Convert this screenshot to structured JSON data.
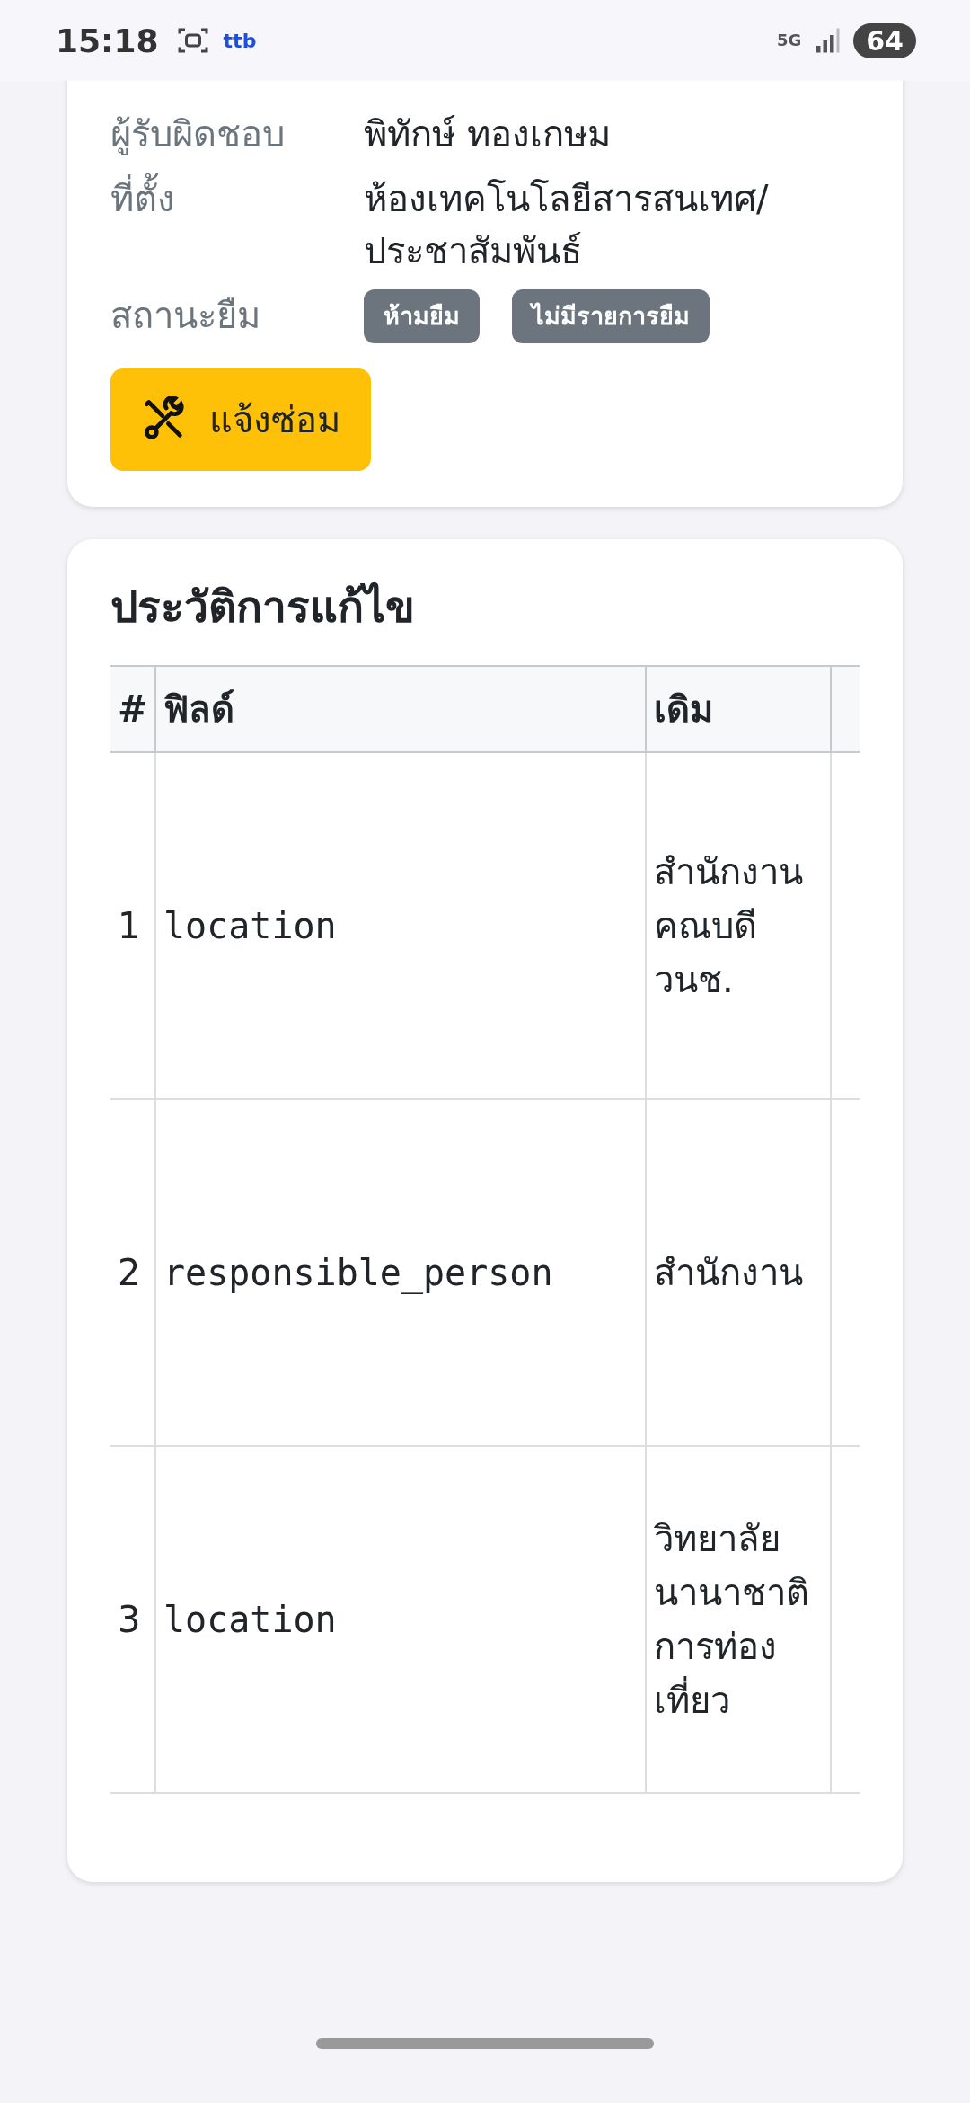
{
  "status_bar": {
    "time": "15:18",
    "app_logo": "ttb",
    "network": "5G",
    "battery": "64"
  },
  "details": [
    {
      "label": "ผู้รับผิดชอบ",
      "value": "พิทักษ์ ทองเกษม"
    },
    {
      "label": "ที่ตั้ง",
      "value": "ห้องเทคโนโลยีสารสนเทศ/ประชาสัมพันธ์"
    },
    {
      "label": "สถานะยืม",
      "badges": [
        "ห้ามยืม",
        "ไม่มีรายการยืม"
      ]
    }
  ],
  "repair_button": "แจ้งซ่อม",
  "history": {
    "title": "ประวัติการแก้ไข",
    "columns": [
      "#",
      "ฟิลด์",
      "เดิม"
    ],
    "rows": [
      {
        "cells": [
          "1",
          "location",
          "สำนักงานคณบดี วนช."
        ]
      },
      {
        "cells": [
          "2",
          "responsible_person",
          "สำนักงาน"
        ]
      },
      {
        "cells": [
          "3",
          "location",
          "วิทยาลัยนานาชาติการท่องเที่ยว"
        ]
      }
    ]
  }
}
